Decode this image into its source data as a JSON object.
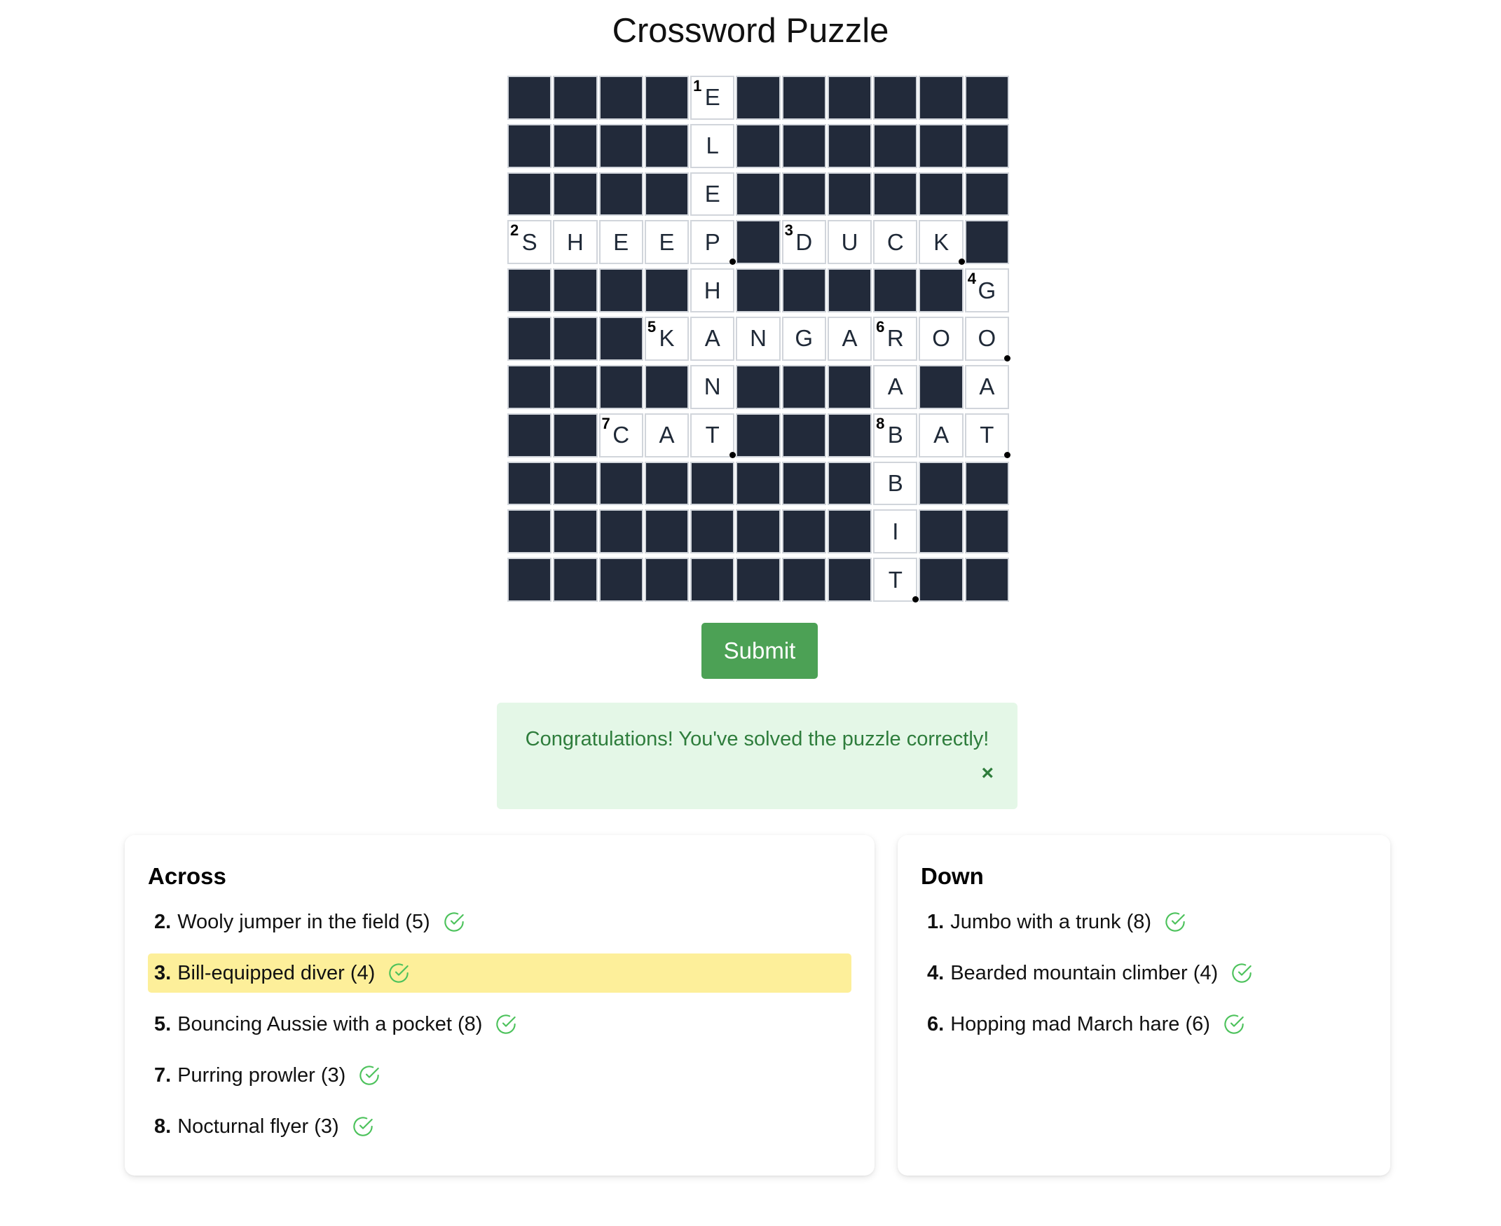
{
  "title": "Crossword Puzzle",
  "grid": [
    [
      "#",
      "#",
      "#",
      "#",
      "E",
      "#",
      "#",
      "#",
      "#",
      "#",
      "#"
    ],
    [
      "#",
      "#",
      "#",
      "#",
      "L",
      "#",
      "#",
      "#",
      "#",
      "#",
      "#"
    ],
    [
      "#",
      "#",
      "#",
      "#",
      "E",
      "#",
      "#",
      "#",
      "#",
      "#",
      "#"
    ],
    [
      "S",
      "H",
      "E",
      "E",
      "P",
      "#",
      "D",
      "U",
      "C",
      "K",
      "#"
    ],
    [
      "#",
      "#",
      "#",
      "#",
      "H",
      "#",
      "#",
      "#",
      "#",
      "#",
      "G"
    ],
    [
      "#",
      "#",
      "#",
      "K",
      "A",
      "N",
      "G",
      "A",
      "R",
      "O",
      "O"
    ],
    [
      "#",
      "#",
      "#",
      "#",
      "N",
      "#",
      "#",
      "#",
      "A",
      "#",
      "A"
    ],
    [
      "#",
      "#",
      "C",
      "A",
      "T",
      "#",
      "#",
      "#",
      "B",
      "A",
      "T"
    ],
    [
      "#",
      "#",
      "#",
      "#",
      "#",
      "#",
      "#",
      "#",
      "B",
      "#",
      "#"
    ],
    [
      "#",
      "#",
      "#",
      "#",
      "#",
      "#",
      "#",
      "#",
      "I",
      "#",
      "#"
    ],
    [
      "#",
      "#",
      "#",
      "#",
      "#",
      "#",
      "#",
      "#",
      "T",
      "#",
      "#"
    ]
  ],
  "numbers": [
    {
      "row": 0,
      "col": 4,
      "n": "1"
    },
    {
      "row": 3,
      "col": 0,
      "n": "2"
    },
    {
      "row": 3,
      "col": 6,
      "n": "3"
    },
    {
      "row": 4,
      "col": 10,
      "n": "4"
    },
    {
      "row": 5,
      "col": 3,
      "n": "5"
    },
    {
      "row": 5,
      "col": 8,
      "n": "6"
    },
    {
      "row": 7,
      "col": 2,
      "n": "7"
    },
    {
      "row": 7,
      "col": 8,
      "n": "8"
    }
  ],
  "word_end_markers": [
    {
      "row": 3,
      "col": 4
    },
    {
      "row": 3,
      "col": 9
    },
    {
      "row": 5,
      "col": 10
    },
    {
      "row": 7,
      "col": 4
    },
    {
      "row": 7,
      "col": 10
    },
    {
      "row": 10,
      "col": 8
    }
  ],
  "submit_label": "Submit",
  "alert": {
    "message": "Congratulations! You've solved the puzzle correctly!",
    "close_label": "×"
  },
  "across": {
    "heading": "Across",
    "clues": [
      {
        "num": "2.",
        "text": "Wooly jumper in the field (5)",
        "solved": true,
        "active": false
      },
      {
        "num": "3.",
        "text": "Bill-equipped diver (4)",
        "solved": true,
        "active": true
      },
      {
        "num": "5.",
        "text": "Bouncing Aussie with a pocket (8)",
        "solved": true,
        "active": false
      },
      {
        "num": "7.",
        "text": "Purring prowler (3)",
        "solved": true,
        "active": false
      },
      {
        "num": "8.",
        "text": "Nocturnal flyer (3)",
        "solved": true,
        "active": false
      }
    ]
  },
  "down": {
    "heading": "Down",
    "clues": [
      {
        "num": "1.",
        "text": "Jumbo with a trunk (8)",
        "solved": true,
        "active": false
      },
      {
        "num": "4.",
        "text": "Bearded mountain climber (4)",
        "solved": true,
        "active": false
      },
      {
        "num": "6.",
        "text": "Hopping mad March hare (6)",
        "solved": true,
        "active": false
      }
    ]
  },
  "colors": {
    "black_cell": "#222a3a",
    "submit": "#4ca155",
    "alert_bg": "#e4f7e7",
    "alert_text": "#2e7d3c",
    "active_clue": "#fdef9a",
    "check": "#4cc25b"
  },
  "icons": {
    "check": "check-circle-icon",
    "close": "close-icon"
  }
}
